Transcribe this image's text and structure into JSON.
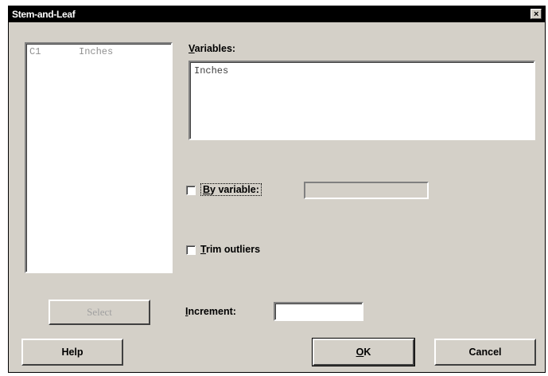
{
  "window": {
    "title": "Stem-and-Leaf",
    "close_glyph": "×"
  },
  "variable_list": {
    "items": [
      {
        "column": "C1",
        "name": "Inches"
      }
    ]
  },
  "variables": {
    "label_accel": "V",
    "label_rest": "ariables:",
    "value": "Inches"
  },
  "by_variable": {
    "label_accel": "B",
    "label_rest": "y variable:",
    "checked": false,
    "value": ""
  },
  "trim_outliers": {
    "label_accel": "T",
    "label_rest": "rim outliers",
    "checked": false
  },
  "increment": {
    "label_accel": "I",
    "label_rest": "ncrement:",
    "value": ""
  },
  "buttons": {
    "select": "Select",
    "help": "Help",
    "ok_accel": "O",
    "ok_rest": "K",
    "cancel": "Cancel"
  }
}
